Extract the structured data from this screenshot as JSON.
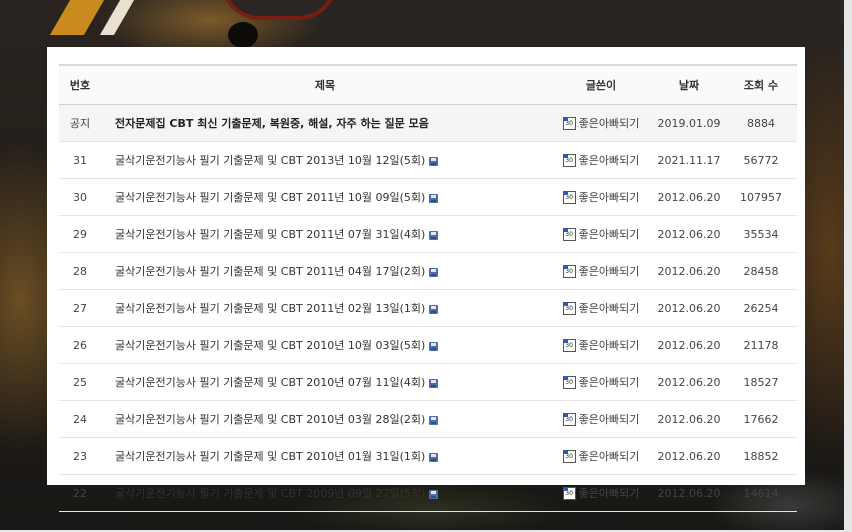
{
  "board": {
    "headers": {
      "num": "번호",
      "title": "제목",
      "author": "글쓴이",
      "date": "날짜",
      "views": "조회 수"
    },
    "notice": {
      "num": "공지",
      "title": "전자문제집 CBT 최신 기출문제, 복원중, 해설, 자주 하는 질문 모음",
      "author": "좋은아빠되기",
      "date": "2019.01.09",
      "views": "8884"
    },
    "rows": [
      {
        "num": "31",
        "title": "굴삭기운전기능사 필기 기출문제 및 CBT 2013년 10월 12일(5회)",
        "author": "좋은아빠되기",
        "date": "2021.11.17",
        "views": "56772"
      },
      {
        "num": "30",
        "title": "굴삭기운전기능사 필기 기출문제 및 CBT 2011년 10월 09일(5회)",
        "author": "좋은아빠되기",
        "date": "2012.06.20",
        "views": "107957"
      },
      {
        "num": "29",
        "title": "굴삭기운전기능사 필기 기출문제 및 CBT 2011년 07월 31일(4회)",
        "author": "좋은아빠되기",
        "date": "2012.06.20",
        "views": "35534"
      },
      {
        "num": "28",
        "title": "굴삭기운전기능사 필기 기출문제 및 CBT 2011년 04월 17일(2회)",
        "author": "좋은아빠되기",
        "date": "2012.06.20",
        "views": "28458"
      },
      {
        "num": "27",
        "title": "굴삭기운전기능사 필기 기출문제 및 CBT 2011년 02월 13일(1회)",
        "author": "좋은아빠되기",
        "date": "2012.06.20",
        "views": "26254"
      },
      {
        "num": "26",
        "title": "굴삭기운전기능사 필기 기출문제 및 CBT 2010년 10월 03일(5회)",
        "author": "좋은아빠되기",
        "date": "2012.06.20",
        "views": "21178"
      },
      {
        "num": "25",
        "title": "굴삭기운전기능사 필기 기출문제 및 CBT 2010년 07월 11일(4회)",
        "author": "좋은아빠되기",
        "date": "2012.06.20",
        "views": "18527"
      },
      {
        "num": "24",
        "title": "굴삭기운전기능사 필기 기출문제 및 CBT 2010년 03월 28일(2회)",
        "author": "좋은아빠되기",
        "date": "2012.06.20",
        "views": "17662"
      },
      {
        "num": "23",
        "title": "굴삭기운전기능사 필기 기출문제 및 CBT 2010년 01월 31일(1회)",
        "author": "좋은아빠되기",
        "date": "2012.06.20",
        "views": "18852"
      },
      {
        "num": "22",
        "title": "굴삭기운전기능사 필기 기출문제 및 CBT 2009년 09월 27일(5회)",
        "author": "좋은아빠되기",
        "date": "2012.06.20",
        "views": "14614"
      }
    ],
    "level_badge_text": "30",
    "icons": {
      "level": "member-level-icon",
      "attachment": "floppy-disk-icon"
    }
  }
}
